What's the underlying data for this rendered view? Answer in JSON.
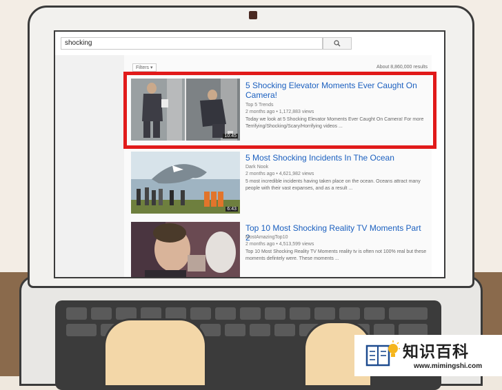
{
  "search": {
    "query": "shocking"
  },
  "results_header": {
    "filters_label": "Filters ▾",
    "count": "About 8,860,000 results"
  },
  "videos": [
    {
      "title": "5 Shocking Elevator Moments Ever Caught On Camera!",
      "channel": "Top 5 Trends",
      "meta": "2 months ago • 1,172,883 views",
      "description": "Today we look at 5 Shocking Elevator Moments Ever Caught On Camera! For more Terrifying/Shocking/Scary/Horrifying videos ...",
      "duration": "10:45",
      "highlighted": true
    },
    {
      "title": "5 Most Shocking Incidents In The Ocean",
      "channel": "Dark Nook",
      "meta": "2 months ago • 4,621,982 views",
      "description": "5 most incredible incidents having taken place on the ocean. Oceans attract many people with their vast expanses, and as a result ...",
      "duration": "6:43",
      "highlighted": false
    },
    {
      "title": "Top 10 Most Shocking Reality TV Moments Part 2",
      "channel": "MostAmazingTop10",
      "meta": "2 months ago • 4,513,599 views",
      "description": "Top 10 Most Shocking Reality TV Moments reality tv is often not 100% real but these moments defintely were. These moments ...",
      "duration": "",
      "highlighted": false
    }
  ],
  "watermark": {
    "text": "知识百科",
    "url": "www.mimingshi.com"
  },
  "colors": {
    "highlight": "#e11a1a",
    "link": "#1a5fbf"
  }
}
